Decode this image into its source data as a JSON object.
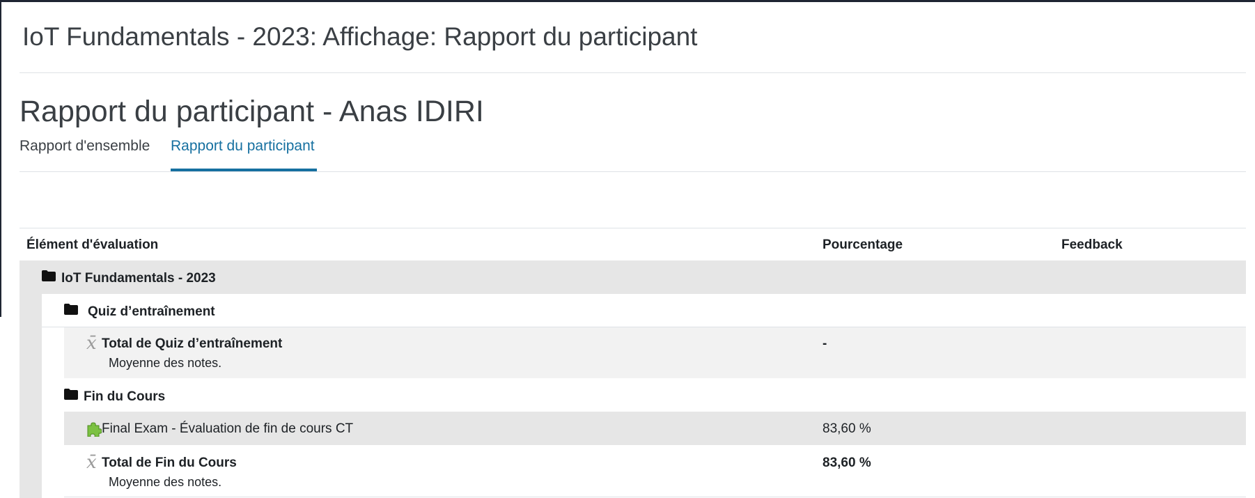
{
  "page": {
    "header_title": "IoT Fundamentals - 2023: Affichage: Rapport du participant",
    "report_title": "Rapport du participant - Anas IDIRI"
  },
  "tabs": [
    {
      "label": "Rapport d'ensemble",
      "active": false
    },
    {
      "label": "Rapport du participant",
      "active": true
    }
  ],
  "colors": {
    "accent": "#1670a0",
    "row_shade": "#e6e6e6",
    "row_shade_light": "#f2f2f2"
  },
  "table": {
    "headers": {
      "item": "Élément d'évaluation",
      "percentage": "Pourcentage",
      "feedback": "Feedback"
    },
    "rows": [
      {
        "type": "category",
        "icon": "folder-icon",
        "label": "IoT Fundamentals - 2023",
        "percentage": "",
        "feedback": ""
      },
      {
        "type": "category",
        "icon": "folder-icon",
        "label": "Quiz d’entraînement",
        "percentage": "",
        "feedback": ""
      },
      {
        "type": "total",
        "icon": "mean-icon",
        "label": "Total de Quiz d’entraînement",
        "sub": "Moyenne des notes.",
        "percentage": "-",
        "feedback": ""
      },
      {
        "type": "category",
        "icon": "folder-icon",
        "label": "Fin du Cours",
        "percentage": "",
        "feedback": ""
      },
      {
        "type": "item",
        "icon": "puzzle-icon",
        "label": "Final Exam - Évaluation de fin de cours CT",
        "percentage": "83,60 %",
        "feedback": ""
      },
      {
        "type": "total",
        "icon": "mean-icon",
        "label": "Total de Fin du Cours",
        "sub": "Moyenne des notes.",
        "percentage": "83,60 %",
        "feedback": ""
      }
    ]
  }
}
